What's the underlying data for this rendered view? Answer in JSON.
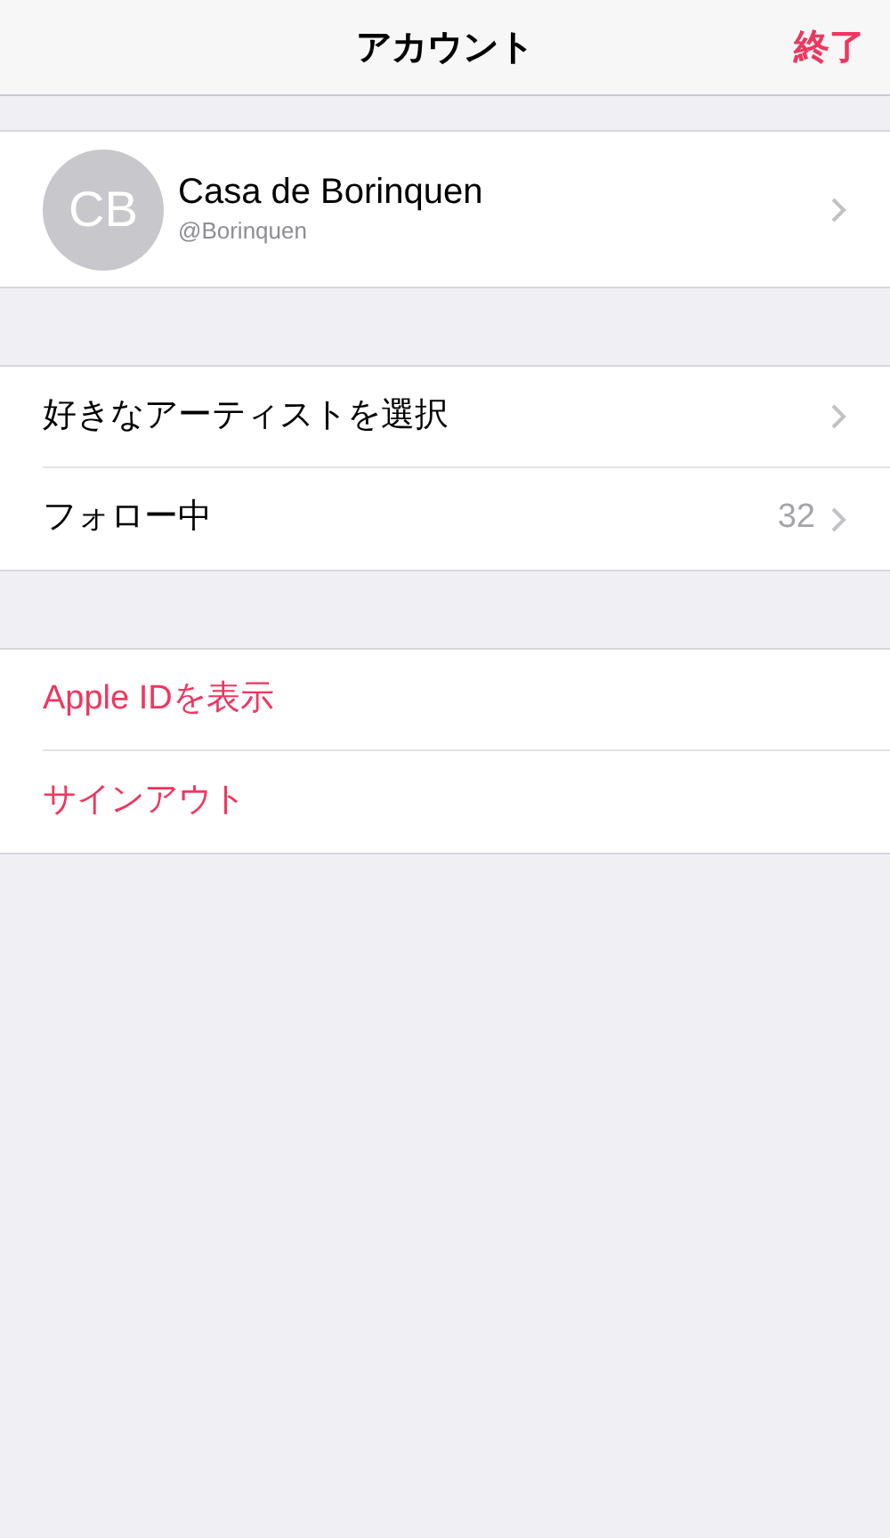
{
  "nav": {
    "title": "アカウント",
    "done": "終了"
  },
  "profile": {
    "initials": "CB",
    "name": "Casa de Borinquen",
    "handle": "@Borinquen"
  },
  "sections": [
    {
      "rows": [
        {
          "kind": "link",
          "label": "好きなアーティストを選択"
        },
        {
          "kind": "link",
          "label": "フォロー中",
          "detail": "32"
        }
      ]
    },
    {
      "rows": [
        {
          "kind": "action",
          "label": "Apple IDを表示"
        },
        {
          "kind": "action",
          "label": "サインアウト"
        }
      ]
    }
  ]
}
